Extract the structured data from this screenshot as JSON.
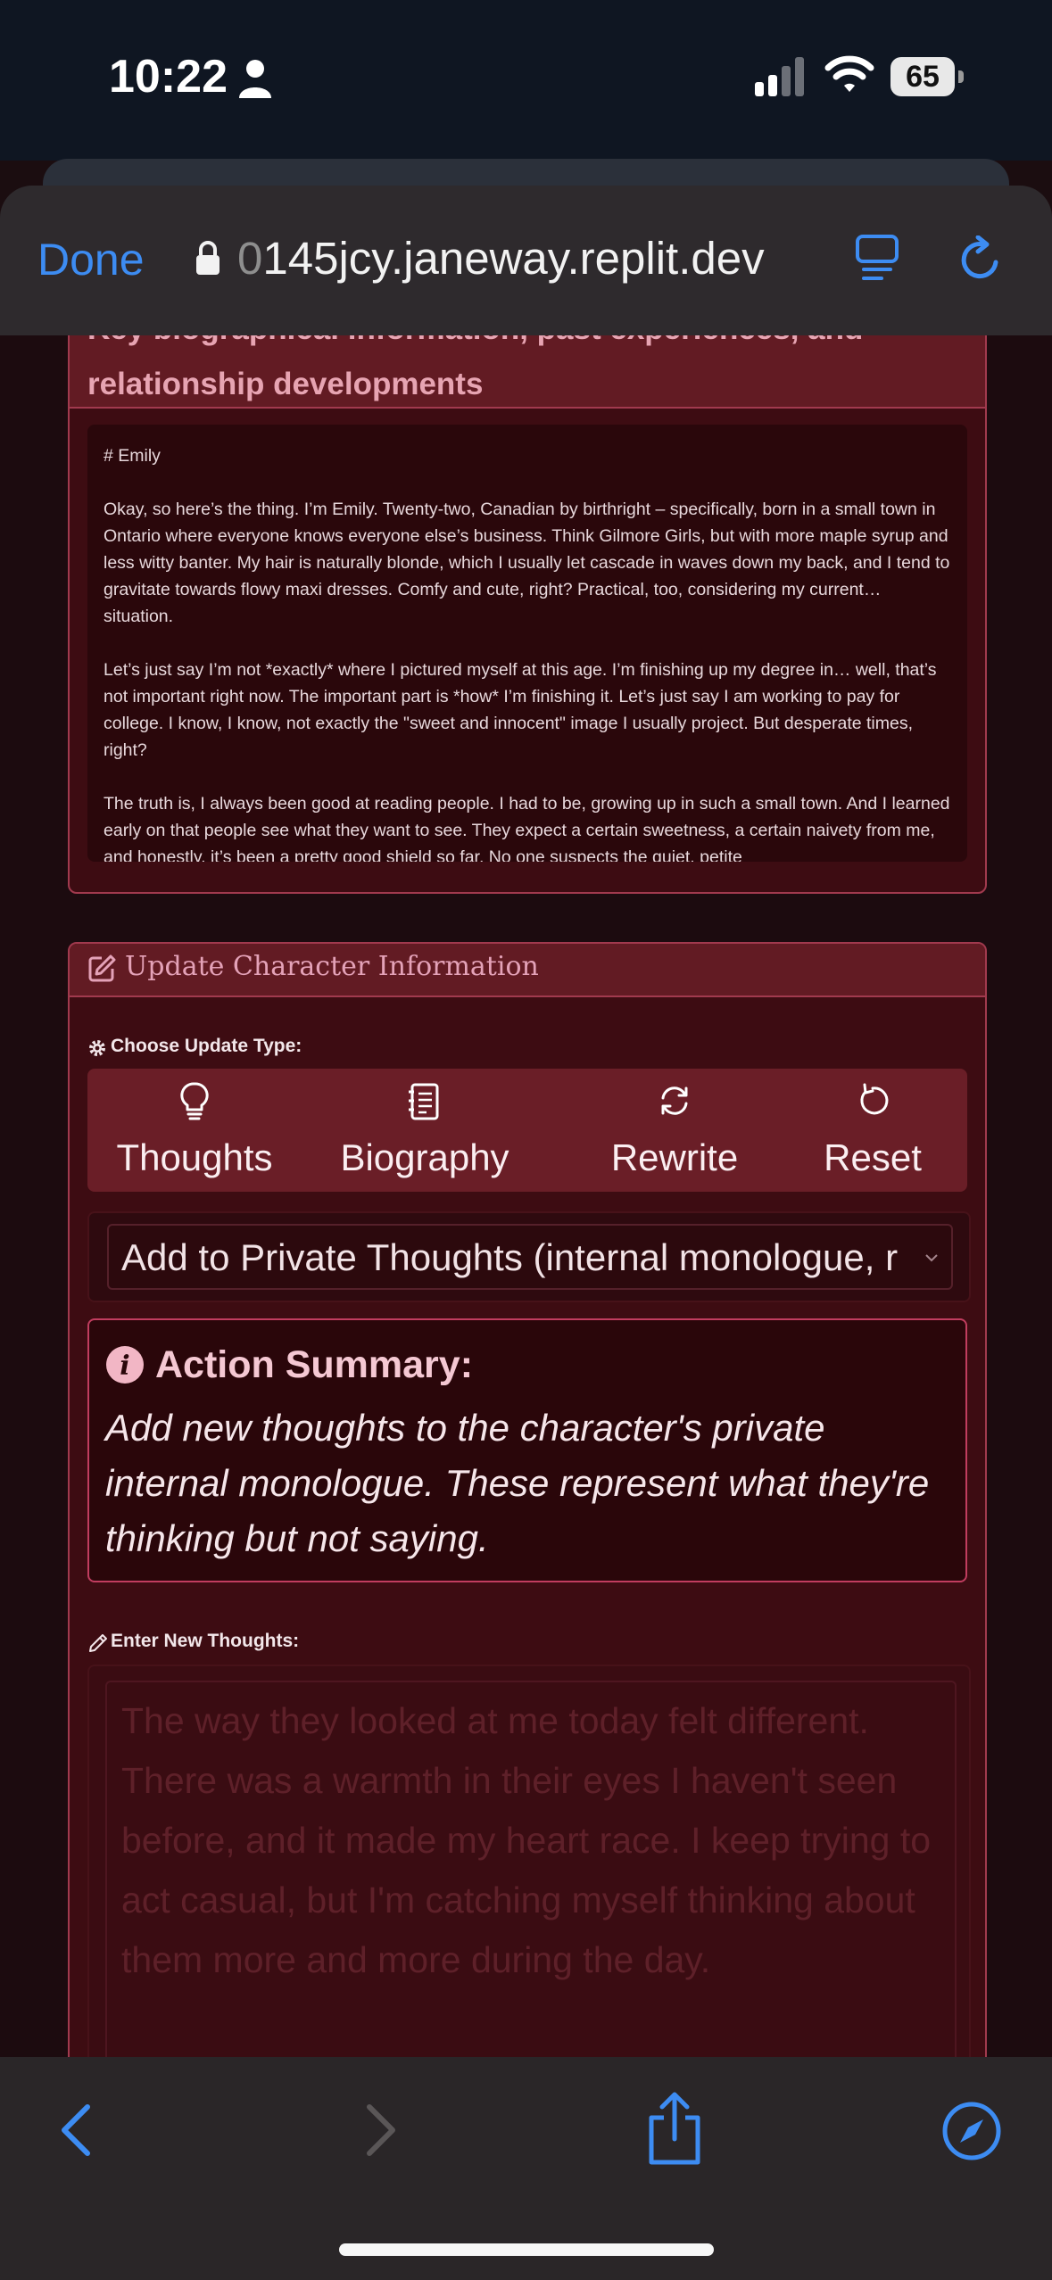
{
  "status_bar": {
    "time": "10:22",
    "battery": "65"
  },
  "browser": {
    "done_label": "Done",
    "url_faded": "0",
    "url": "145jcy.janeway.replit.dev",
    "accent": "#3d8cf2"
  },
  "bio_card": {
    "title": "Key biographical information, past experiences, and relationship developments",
    "heading": "# Emily",
    "paragraphs": [
      "Okay, so here’s the thing. I’m Emily. Twenty-two, Canadian by birthright – specifically, born in a small town in Ontario where everyone knows everyone else’s business. Think Gilmore Girls, but with more maple syrup and less witty banter. My hair is naturally blonde, which I usually let cascade in waves down my back, and I tend to gravitate towards flowy maxi dresses. Comfy and cute, right? Practical, too, considering my current… situation.",
      "Let’s just say I’m not *exactly* where I pictured myself at this age. I’m finishing up my degree in… well, that’s not important right now. The important part is *how* I’m finishing it. Let’s just say I am working to pay for college. I know, I know, not exactly the \"sweet and innocent\" image I usually project. But desperate times, right?",
      "The truth is, I always been good at reading people. I had to be, growing up in such a small town. And I learned early on that people see what they want to see. They expect a certain sweetness, a certain naivety from me, and honestly, it’s been a pretty good shield so far. No one suspects the quiet, petite"
    ]
  },
  "update_card": {
    "title": "Update Character Information",
    "choose_label": "Choose Update Type:",
    "types": [
      {
        "label": "Thoughts",
        "icon": "lightbulb-icon"
      },
      {
        "label": "Biography",
        "icon": "notebook-icon"
      },
      {
        "label": "Rewrite",
        "icon": "sync-icon"
      },
      {
        "label": "Reset",
        "icon": "reset-icon"
      }
    ],
    "select_value": "Add to Private Thoughts (internal monologue, r",
    "summary_title": "Action Summary:",
    "summary_text": "Add new thoughts to the character's private internal monologue. These represent what they're thinking but not saying.",
    "thoughts_label": "Enter New Thoughts:",
    "thoughts_placeholder": "The way they looked at me today felt different. There was a warmth in their eyes I haven't seen before, and it made my heart race. I keep trying to act casual, but I'm catching myself thinking about them more and more during the day."
  }
}
